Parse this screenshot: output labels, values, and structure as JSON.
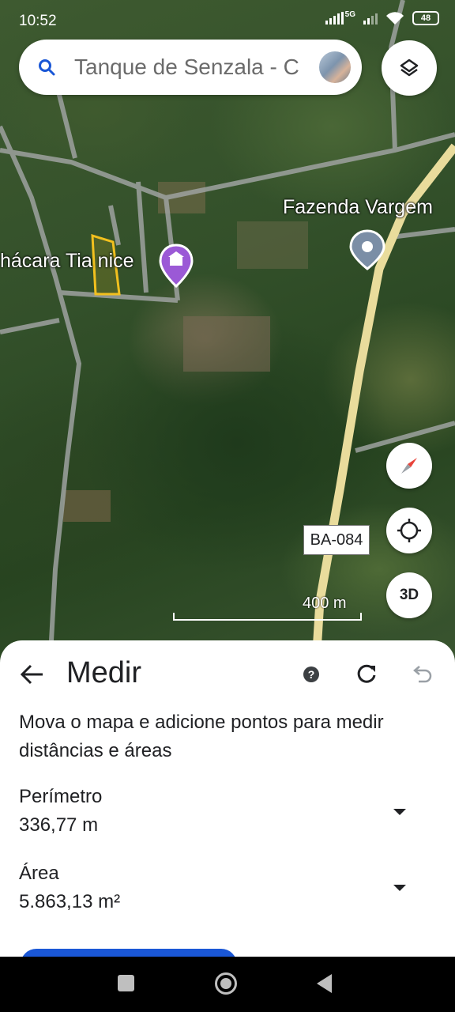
{
  "status_bar": {
    "time": "10:52",
    "network": "5G",
    "battery": "48"
  },
  "search": {
    "text": "Tanque de Senzala - C"
  },
  "map": {
    "labels": {
      "place_left": "hácara Tia nice",
      "place_right": "Fazenda Vargem"
    },
    "road_shield": "BA-084",
    "scale": "400 m",
    "btn_3d": "3D"
  },
  "sheet": {
    "title": "Medir",
    "description": "Mova o mapa e adicione pontos para medir distâncias e áreas",
    "perimeter": {
      "label": "Perímetro",
      "value": "336,77 m"
    },
    "area": {
      "label": "Área",
      "value": "5.863,13 m²"
    }
  },
  "colors": {
    "accent_blue": "#1a57d6",
    "road_yellow": "#efe3a2",
    "outline_yellow": "#f2c01e",
    "pin_purple": "#9b59d6"
  },
  "icons": {
    "search": "search-icon",
    "layers": "layers-icon",
    "compass": "compass-icon",
    "locate": "my-location-icon",
    "help": "help-icon",
    "redo": "refresh-icon",
    "undo": "undo-icon",
    "back": "back-arrow-icon"
  }
}
